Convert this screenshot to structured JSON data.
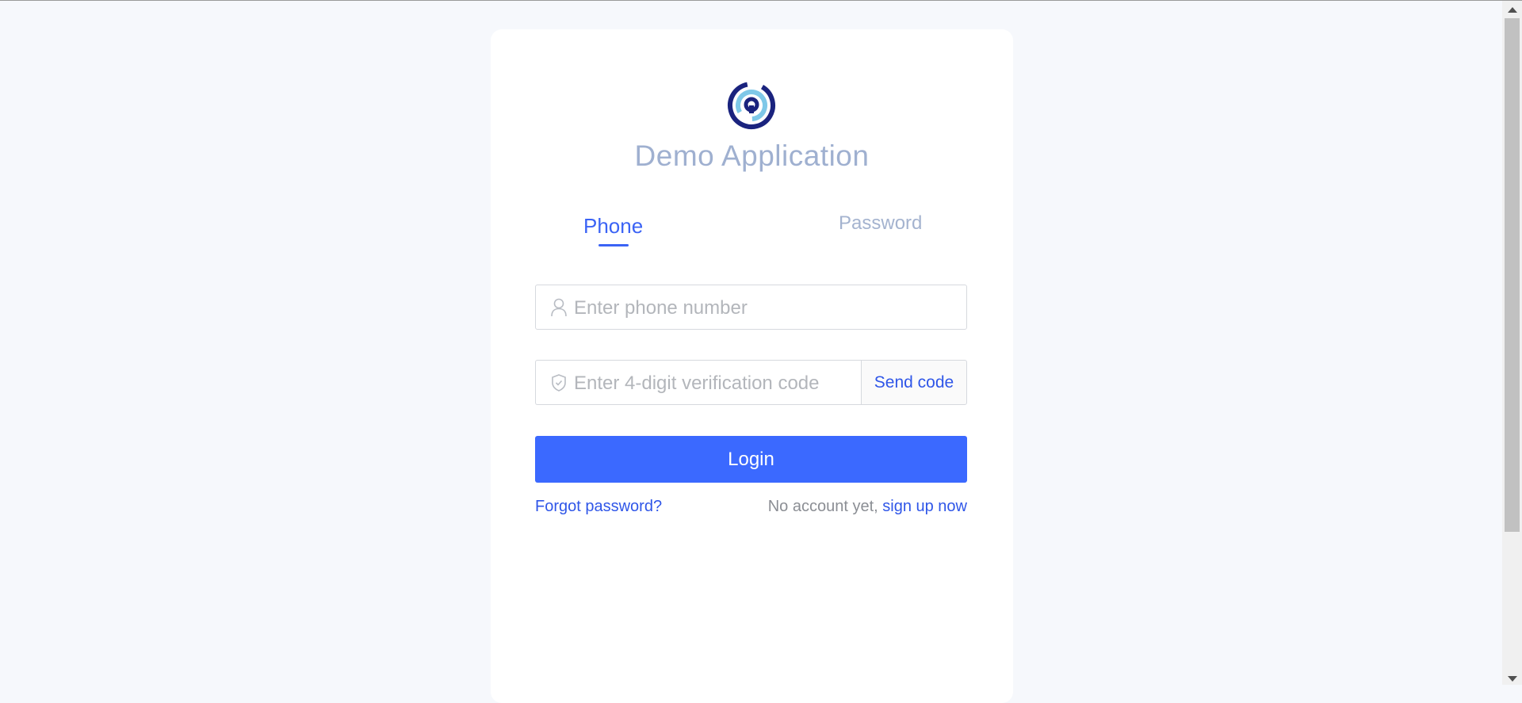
{
  "app": {
    "title": "Demo Application",
    "logo_icon": "app-logo-icon"
  },
  "tabs": [
    {
      "label": "Phone",
      "active": true
    },
    {
      "label": "Password",
      "active": false
    }
  ],
  "form": {
    "phone_placeholder": "Enter phone number",
    "phone_value": "",
    "phone_icon": "user-icon",
    "code_placeholder": "Enter 4-digit verification code",
    "code_value": "",
    "code_icon": "shield-icon",
    "send_code_label": "Send code",
    "login_label": "Login"
  },
  "footer": {
    "forgot_label": "Forgot password?",
    "no_account_text": "No account yet, ",
    "signup_label": "sign up now"
  },
  "colors": {
    "accent": "#3b69ff",
    "link": "#2f56e8",
    "title": "#9fb0d0",
    "background": "#f6f8fc"
  }
}
